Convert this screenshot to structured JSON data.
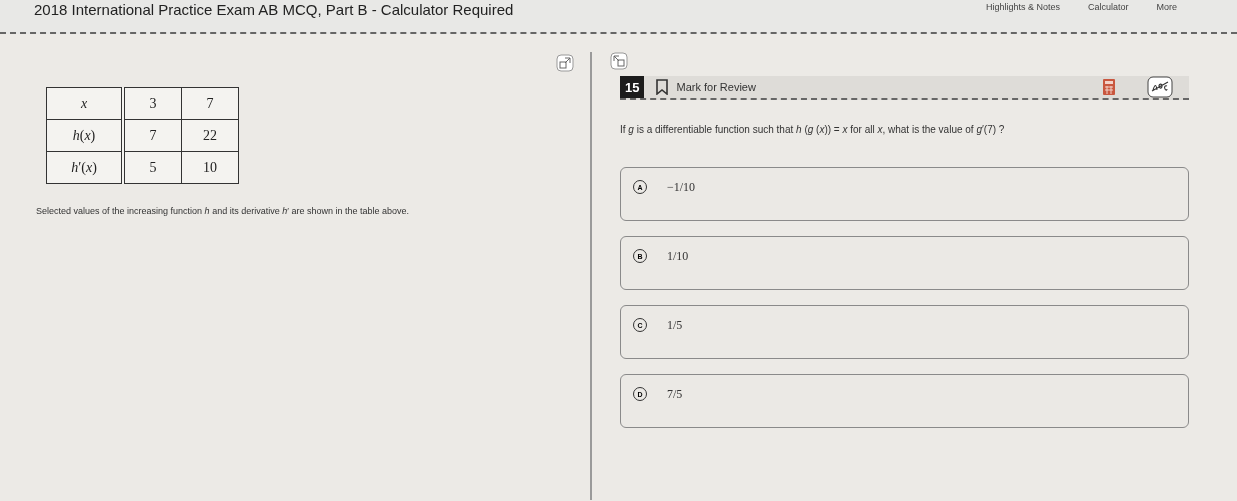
{
  "header": {
    "title": "2018 International Practice Exam AB MCQ, Part B - Calculator Required",
    "tools": [
      "Highlights & Notes",
      "Calculator",
      "More"
    ]
  },
  "stimulus": {
    "table": {
      "rows": [
        [
          "*x*",
          "3",
          "7"
        ],
        [
          "*h*(*x*)",
          "7",
          "22"
        ],
        [
          "*h*′(*x*)",
          "5",
          "10"
        ]
      ]
    },
    "caption": "Selected values of the increasing function *h* and its derivative *h*′ are shown in the table above."
  },
  "question": {
    "number": "15",
    "mark_label": "Mark for Review",
    "marked": false,
    "text": "If *g* is a differentiable function such that *h* (*g* (*x*)) = *x* for all *x*, what is the value of *g*′(7) ?",
    "options": [
      {
        "letter": "A",
        "text": "−1/10",
        "selected": false
      },
      {
        "letter": "B",
        "text": "1/10",
        "selected": false
      },
      {
        "letter": "C",
        "text": "1/5",
        "selected": false
      },
      {
        "letter": "D",
        "text": "7/5",
        "selected": false
      }
    ]
  }
}
